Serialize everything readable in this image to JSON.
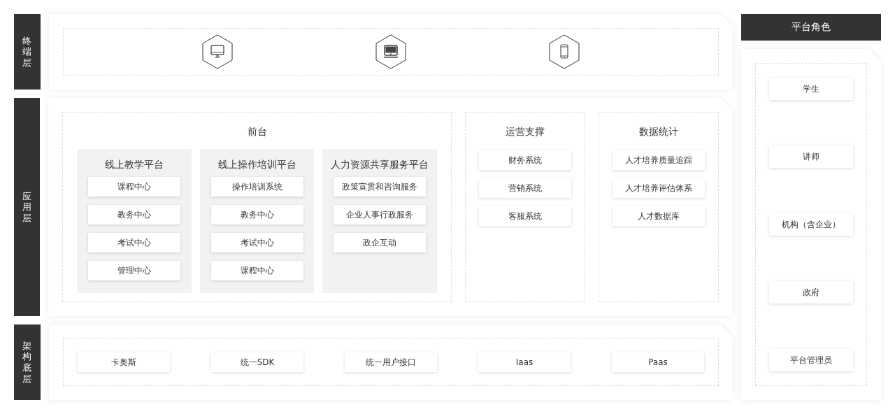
{
  "terminal": {
    "label": "终端层",
    "devices": [
      {
        "kind": "desktop"
      },
      {
        "kind": "laptop"
      },
      {
        "kind": "phone"
      }
    ]
  },
  "application": {
    "label": "应用层",
    "front": {
      "title": "前台",
      "platforms": [
        {
          "title": "线上教学平台",
          "items": [
            "课程中心",
            "教务中心",
            "考试中心",
            "管理中心"
          ]
        },
        {
          "title": "线上操作培训平台",
          "items": [
            "操作培训系统",
            "教务中心",
            "考试中心",
            "课程中心"
          ]
        },
        {
          "title": "人力资源共享服务平台",
          "items": [
            "政策宣贯和咨询服务",
            "企业人事行政服务",
            "政企互动"
          ]
        }
      ]
    },
    "groups": [
      {
        "title": "运营支撑",
        "items": [
          "财务系统",
          "营销系统",
          "客服系统"
        ]
      },
      {
        "title": "数据统计",
        "items": [
          "人才培养质量追踪",
          "人才培养评估体系",
          "人才数据库"
        ]
      }
    ]
  },
  "base": {
    "label": "架构底层",
    "items": [
      "卡奥斯",
      "统一SDK",
      "统一用户接口",
      "Iaas",
      "Paas"
    ]
  },
  "roles": {
    "title": "平台角色",
    "items": [
      "学生",
      "讲师",
      "机构（含企业）",
      "政府",
      "平台管理员"
    ]
  }
}
